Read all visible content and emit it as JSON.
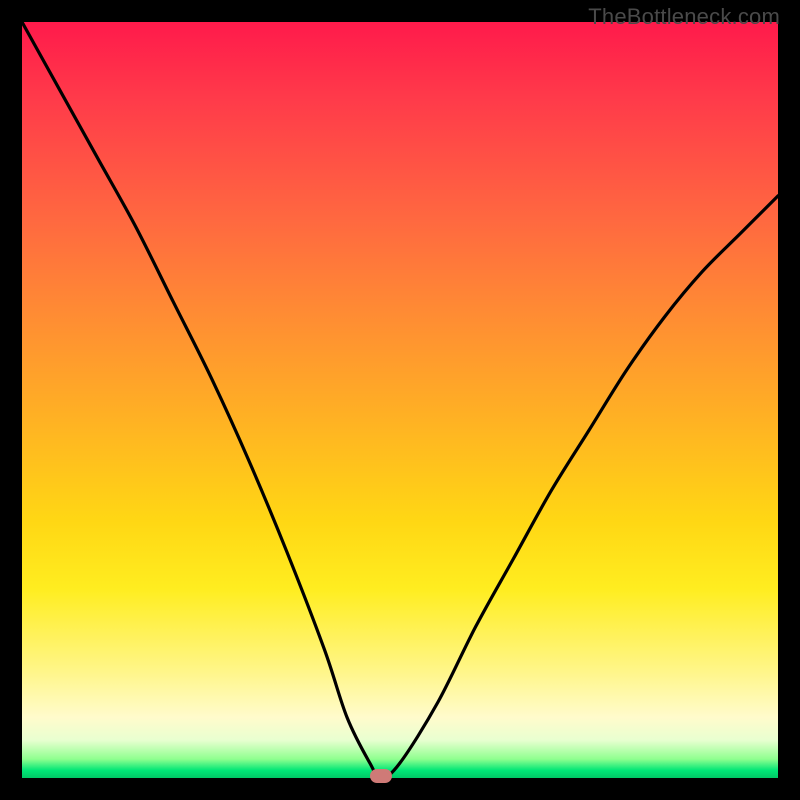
{
  "watermark": "TheBottleneck.com",
  "chart_data": {
    "type": "line",
    "title": "",
    "xlabel": "",
    "ylabel": "",
    "xlim": [
      0,
      100
    ],
    "ylim": [
      0,
      100
    ],
    "grid": false,
    "series": [
      {
        "name": "curve",
        "x": [
          0,
          5,
          10,
          15,
          20,
          25,
          30,
          35,
          40,
          43,
          46,
          47.5,
          50,
          55,
          60,
          65,
          70,
          75,
          80,
          85,
          90,
          95,
          100
        ],
        "values": [
          100,
          91,
          82,
          73,
          63,
          53,
          42,
          30,
          17,
          8,
          2,
          0,
          2,
          10,
          20,
          29,
          38,
          46,
          54,
          61,
          67,
          72,
          77
        ]
      }
    ],
    "marker": {
      "x": 47.5,
      "y": 0,
      "color": "#cf7a77"
    },
    "background_gradient": {
      "top": "#ff1a4b",
      "mid": "#ffd714",
      "bottom": "#00c866"
    }
  }
}
